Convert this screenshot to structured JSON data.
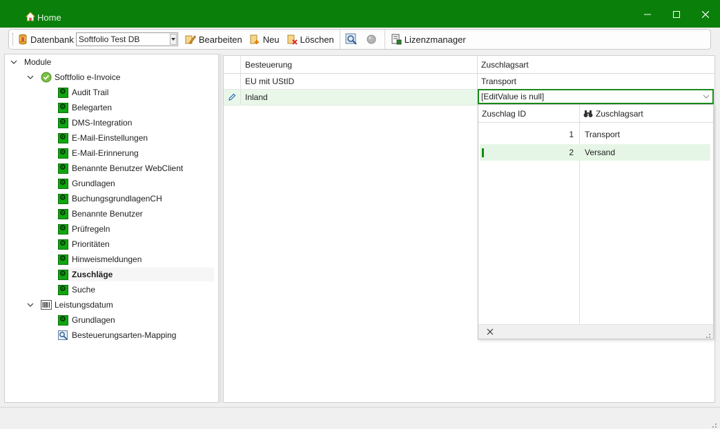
{
  "window": {
    "title": "Home",
    "title_bar_color": "#0a7f0a",
    "controls": [
      "minimize-icon",
      "maximize-icon",
      "close-icon"
    ]
  },
  "toolbar": {
    "database_label": "Datenbank",
    "database_value": "Softfolio Test DB",
    "edit_label": "Bearbeiten",
    "new_label": "Neu",
    "delete_label": "Löschen",
    "license_label": "Lizenzmanager"
  },
  "tree": {
    "root": "Module",
    "groups": [
      {
        "label": "Softfolio e-Invoice",
        "items": [
          "Audit Trail",
          "Belegarten",
          "DMS-Integration",
          "E-Mail-Einstellungen",
          "E-Mail-Erinnerung",
          "Benannte Benutzer WebClient",
          "Grundlagen",
          "BuchungsgrundlagenCH",
          "Benannte Benutzer",
          "Prüfregeln",
          "Prioritäten",
          "Hinweismeldungen",
          "Zuschläge",
          "Suche"
        ],
        "selected": "Zuschläge"
      },
      {
        "label": "Leistungsdatum",
        "items": [
          "Grundlagen",
          "Besteuerungsarten-Mapping"
        ]
      }
    ]
  },
  "grid": {
    "columns": [
      "Besteuerung",
      "Zuschlagsart"
    ],
    "rows": [
      {
        "besteuerung": "EU mit UStID",
        "zuschlagsart": "Transport"
      },
      {
        "besteuerung": "Inland",
        "zuschlagsart": "[EditValue is null]"
      }
    ]
  },
  "lookup": {
    "columns": [
      "Zuschlag ID",
      "Zuschlagsart"
    ],
    "rows": [
      {
        "id": "1",
        "name": "Transport"
      },
      {
        "id": "2",
        "name": "Versand"
      }
    ],
    "selected_id": "2"
  }
}
